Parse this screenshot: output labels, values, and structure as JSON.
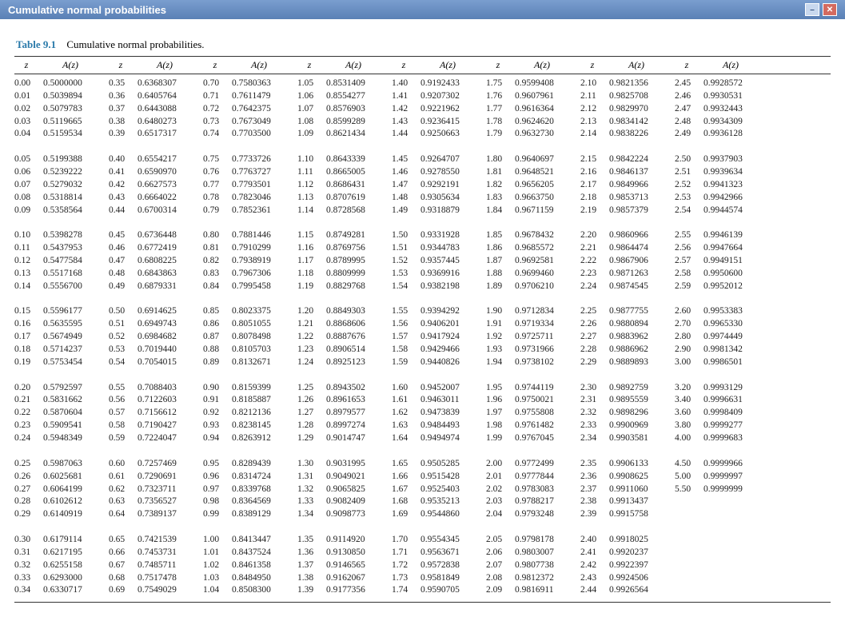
{
  "window": {
    "title": "Cumulative normal probabilities"
  },
  "table": {
    "label": "Table 9.1",
    "caption": "Cumulative normal probabilities.",
    "col_z": "z",
    "col_a": "A(z)",
    "columns": [
      {
        "z": [
          "0.00",
          "0.01",
          "0.02",
          "0.03",
          "0.04",
          "",
          "0.05",
          "0.06",
          "0.07",
          "0.08",
          "0.09",
          "",
          "0.10",
          "0.11",
          "0.12",
          "0.13",
          "0.14",
          "",
          "0.15",
          "0.16",
          "0.17",
          "0.18",
          "0.19",
          "",
          "0.20",
          "0.21",
          "0.22",
          "0.23",
          "0.24",
          "",
          "0.25",
          "0.26",
          "0.27",
          "0.28",
          "0.29",
          "",
          "0.30",
          "0.31",
          "0.32",
          "0.33",
          "0.34"
        ],
        "a": [
          "0.5000000",
          "0.5039894",
          "0.5079783",
          "0.5119665",
          "0.5159534",
          "",
          "0.5199388",
          "0.5239222",
          "0.5279032",
          "0.5318814",
          "0.5358564",
          "",
          "0.5398278",
          "0.5437953",
          "0.5477584",
          "0.5517168",
          "0.5556700",
          "",
          "0.5596177",
          "0.5635595",
          "0.5674949",
          "0.5714237",
          "0.5753454",
          "",
          "0.5792597",
          "0.5831662",
          "0.5870604",
          "0.5909541",
          "0.5948349",
          "",
          "0.5987063",
          "0.6025681",
          "0.6064199",
          "0.6102612",
          "0.6140919",
          "",
          "0.6179114",
          "0.6217195",
          "0.6255158",
          "0.6293000",
          "0.6330717"
        ]
      },
      {
        "z": [
          "0.35",
          "0.36",
          "0.37",
          "0.38",
          "0.39",
          "",
          "0.40",
          "0.41",
          "0.42",
          "0.43",
          "0.44",
          "",
          "0.45",
          "0.46",
          "0.47",
          "0.48",
          "0.49",
          "",
          "0.50",
          "0.51",
          "0.52",
          "0.53",
          "0.54",
          "",
          "0.55",
          "0.56",
          "0.57",
          "0.58",
          "0.59",
          "",
          "0.60",
          "0.61",
          "0.62",
          "0.63",
          "0.64",
          "",
          "0.65",
          "0.66",
          "0.67",
          "0.68",
          "0.69"
        ],
        "a": [
          "0.6368307",
          "0.6405764",
          "0.6443088",
          "0.6480273",
          "0.6517317",
          "",
          "0.6554217",
          "0.6590970",
          "0.6627573",
          "0.6664022",
          "0.6700314",
          "",
          "0.6736448",
          "0.6772419",
          "0.6808225",
          "0.6843863",
          "0.6879331",
          "",
          "0.6914625",
          "0.6949743",
          "0.6984682",
          "0.7019440",
          "0.7054015",
          "",
          "0.7088403",
          "0.7122603",
          "0.7156612",
          "0.7190427",
          "0.7224047",
          "",
          "0.7257469",
          "0.7290691",
          "0.7323711",
          "0.7356527",
          "0.7389137",
          "",
          "0.7421539",
          "0.7453731",
          "0.7485711",
          "0.7517478",
          "0.7549029"
        ]
      },
      {
        "z": [
          "0.70",
          "0.71",
          "0.72",
          "0.73",
          "0.74",
          "",
          "0.75",
          "0.76",
          "0.77",
          "0.78",
          "0.79",
          "",
          "0.80",
          "0.81",
          "0.82",
          "0.83",
          "0.84",
          "",
          "0.85",
          "0.86",
          "0.87",
          "0.88",
          "0.89",
          "",
          "0.90",
          "0.91",
          "0.92",
          "0.93",
          "0.94",
          "",
          "0.95",
          "0.96",
          "0.97",
          "0.98",
          "0.99",
          "",
          "1.00",
          "1.01",
          "1.02",
          "1.03",
          "1.04"
        ],
        "a": [
          "0.7580363",
          "0.7611479",
          "0.7642375",
          "0.7673049",
          "0.7703500",
          "",
          "0.7733726",
          "0.7763727",
          "0.7793501",
          "0.7823046",
          "0.7852361",
          "",
          "0.7881446",
          "0.7910299",
          "0.7938919",
          "0.7967306",
          "0.7995458",
          "",
          "0.8023375",
          "0.8051055",
          "0.8078498",
          "0.8105703",
          "0.8132671",
          "",
          "0.8159399",
          "0.8185887",
          "0.8212136",
          "0.8238145",
          "0.8263912",
          "",
          "0.8289439",
          "0.8314724",
          "0.8339768",
          "0.8364569",
          "0.8389129",
          "",
          "0.8413447",
          "0.8437524",
          "0.8461358",
          "0.8484950",
          "0.8508300"
        ]
      },
      {
        "z": [
          "1.05",
          "1.06",
          "1.07",
          "1.08",
          "1.09",
          "",
          "1.10",
          "1.11",
          "1.12",
          "1.13",
          "1.14",
          "",
          "1.15",
          "1.16",
          "1.17",
          "1.18",
          "1.19",
          "",
          "1.20",
          "1.21",
          "1.22",
          "1.23",
          "1.24",
          "",
          "1.25",
          "1.26",
          "1.27",
          "1.28",
          "1.29",
          "",
          "1.30",
          "1.31",
          "1.32",
          "1.33",
          "1.34",
          "",
          "1.35",
          "1.36",
          "1.37",
          "1.38",
          "1.39"
        ],
        "a": [
          "0.8531409",
          "0.8554277",
          "0.8576903",
          "0.8599289",
          "0.8621434",
          "",
          "0.8643339",
          "0.8665005",
          "0.8686431",
          "0.8707619",
          "0.8728568",
          "",
          "0.8749281",
          "0.8769756",
          "0.8789995",
          "0.8809999",
          "0.8829768",
          "",
          "0.8849303",
          "0.8868606",
          "0.8887676",
          "0.8906514",
          "0.8925123",
          "",
          "0.8943502",
          "0.8961653",
          "0.8979577",
          "0.8997274",
          "0.9014747",
          "",
          "0.9031995",
          "0.9049021",
          "0.9065825",
          "0.9082409",
          "0.9098773",
          "",
          "0.9114920",
          "0.9130850",
          "0.9146565",
          "0.9162067",
          "0.9177356"
        ]
      },
      {
        "z": [
          "1.40",
          "1.41",
          "1.42",
          "1.43",
          "1.44",
          "",
          "1.45",
          "1.46",
          "1.47",
          "1.48",
          "1.49",
          "",
          "1.50",
          "1.51",
          "1.52",
          "1.53",
          "1.54",
          "",
          "1.55",
          "1.56",
          "1.57",
          "1.58",
          "1.59",
          "",
          "1.60",
          "1.61",
          "1.62",
          "1.63",
          "1.64",
          "",
          "1.65",
          "1.66",
          "1.67",
          "1.68",
          "1.69",
          "",
          "1.70",
          "1.71",
          "1.72",
          "1.73",
          "1.74"
        ],
        "a": [
          "0.9192433",
          "0.9207302",
          "0.9221962",
          "0.9236415",
          "0.9250663",
          "",
          "0.9264707",
          "0.9278550",
          "0.9292191",
          "0.9305634",
          "0.9318879",
          "",
          "0.9331928",
          "0.9344783",
          "0.9357445",
          "0.9369916",
          "0.9382198",
          "",
          "0.9394292",
          "0.9406201",
          "0.9417924",
          "0.9429466",
          "0.9440826",
          "",
          "0.9452007",
          "0.9463011",
          "0.9473839",
          "0.9484493",
          "0.9494974",
          "",
          "0.9505285",
          "0.9515428",
          "0.9525403",
          "0.9535213",
          "0.9544860",
          "",
          "0.9554345",
          "0.9563671",
          "0.9572838",
          "0.9581849",
          "0.9590705"
        ]
      },
      {
        "z": [
          "1.75",
          "1.76",
          "1.77",
          "1.78",
          "1.79",
          "",
          "1.80",
          "1.81",
          "1.82",
          "1.83",
          "1.84",
          "",
          "1.85",
          "1.86",
          "1.87",
          "1.88",
          "1.89",
          "",
          "1.90",
          "1.91",
          "1.92",
          "1.93",
          "1.94",
          "",
          "1.95",
          "1.96",
          "1.97",
          "1.98",
          "1.99",
          "",
          "2.00",
          "2.01",
          "2.02",
          "2.03",
          "2.04",
          "",
          "2.05",
          "2.06",
          "2.07",
          "2.08",
          "2.09"
        ],
        "a": [
          "0.9599408",
          "0.9607961",
          "0.9616364",
          "0.9624620",
          "0.9632730",
          "",
          "0.9640697",
          "0.9648521",
          "0.9656205",
          "0.9663750",
          "0.9671159",
          "",
          "0.9678432",
          "0.9685572",
          "0.9692581",
          "0.9699460",
          "0.9706210",
          "",
          "0.9712834",
          "0.9719334",
          "0.9725711",
          "0.9731966",
          "0.9738102",
          "",
          "0.9744119",
          "0.9750021",
          "0.9755808",
          "0.9761482",
          "0.9767045",
          "",
          "0.9772499",
          "0.9777844",
          "0.9783083",
          "0.9788217",
          "0.9793248",
          "",
          "0.9798178",
          "0.9803007",
          "0.9807738",
          "0.9812372",
          "0.9816911"
        ]
      },
      {
        "z": [
          "2.10",
          "2.11",
          "2.12",
          "2.13",
          "2.14",
          "",
          "2.15",
          "2.16",
          "2.17",
          "2.18",
          "2.19",
          "",
          "2.20",
          "2.21",
          "2.22",
          "2.23",
          "2.24",
          "",
          "2.25",
          "2.26",
          "2.27",
          "2.28",
          "2.29",
          "",
          "2.30",
          "2.31",
          "2.32",
          "2.33",
          "2.34",
          "",
          "2.35",
          "2.36",
          "2.37",
          "2.38",
          "2.39",
          "",
          "2.40",
          "2.41",
          "2.42",
          "2.43",
          "2.44"
        ],
        "a": [
          "0.9821356",
          "0.9825708",
          "0.9829970",
          "0.9834142",
          "0.9838226",
          "",
          "0.9842224",
          "0.9846137",
          "0.9849966",
          "0.9853713",
          "0.9857379",
          "",
          "0.9860966",
          "0.9864474",
          "0.9867906",
          "0.9871263",
          "0.9874545",
          "",
          "0.9877755",
          "0.9880894",
          "0.9883962",
          "0.9886962",
          "0.9889893",
          "",
          "0.9892759",
          "0.9895559",
          "0.9898296",
          "0.9900969",
          "0.9903581",
          "",
          "0.9906133",
          "0.9908625",
          "0.9911060",
          "0.9913437",
          "0.9915758",
          "",
          "0.9918025",
          "0.9920237",
          "0.9922397",
          "0.9924506",
          "0.9926564"
        ]
      },
      {
        "z": [
          "2.45",
          "2.46",
          "2.47",
          "2.48",
          "2.49",
          "",
          "2.50",
          "2.51",
          "2.52",
          "2.53",
          "2.54",
          "",
          "2.55",
          "2.56",
          "2.57",
          "2.58",
          "2.59",
          "",
          "2.60",
          "2.70",
          "2.80",
          "2.90",
          "3.00",
          "",
          "3.20",
          "3.40",
          "3.60",
          "3.80",
          "4.00",
          "",
          "4.50",
          "5.00",
          "5.50",
          "",
          "",
          "",
          "",
          "",
          "",
          "",
          ""
        ],
        "a": [
          "0.9928572",
          "0.9930531",
          "0.9932443",
          "0.9934309",
          "0.9936128",
          "",
          "0.9937903",
          "0.9939634",
          "0.9941323",
          "0.9942966",
          "0.9944574",
          "",
          "0.9946139",
          "0.9947664",
          "0.9949151",
          "0.9950600",
          "0.9952012",
          "",
          "0.9953383",
          "0.9965330",
          "0.9974449",
          "0.9981342",
          "0.9986501",
          "",
          "0.9993129",
          "0.9996631",
          "0.9998409",
          "0.9999277",
          "0.9999683",
          "",
          "0.9999966",
          "0.9999997",
          "0.9999999",
          "",
          "",
          "",
          "",
          "",
          "",
          "",
          ""
        ]
      }
    ]
  }
}
